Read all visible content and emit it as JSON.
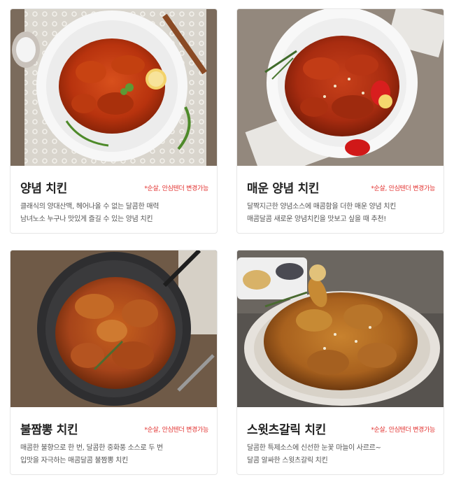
{
  "menu": [
    {
      "title": "양념 치킨",
      "tag": "*순살, 안심텐더 변경가능",
      "desc": [
        "클래식의 양대산맥, 헤어나올 수 없는 달콤한 매력",
        "남녀노소 누구나 맛있게 즐길 수 있는 양념 치킨"
      ]
    },
    {
      "title": "매운 양념 치킨",
      "tag": "*순살, 안심텐더 변경가능",
      "desc": [
        "달짝지근한 양념소스에 매콤함을 더한 매운 양념 치킨",
        "매콤달콤 새로운 양념치킨을 맛보고 싶을 때 추천!"
      ]
    },
    {
      "title": "불짬뽕 치킨",
      "tag": "*순살, 안심텐더 변경가능",
      "desc": [
        "매콤한 불향으로 한 번, 달콤한 중화풍 소스로 두 번",
        "입맛을 자극하는 매콤달콤 불짬뽕 치킨"
      ]
    },
    {
      "title": "스윗츠갈릭 치킨",
      "tag": "*순살, 안심텐더 변경가능",
      "desc": [
        "달콤한 특제소스에 신선한 눈꽃 마늘이 사르르~",
        "달콤 알싸한 스윗츠갈릭 치킨"
      ]
    }
  ],
  "colors": {
    "accent": "#e2312f",
    "title": "#222222",
    "text": "#555555",
    "border": "#e6e6e6"
  }
}
